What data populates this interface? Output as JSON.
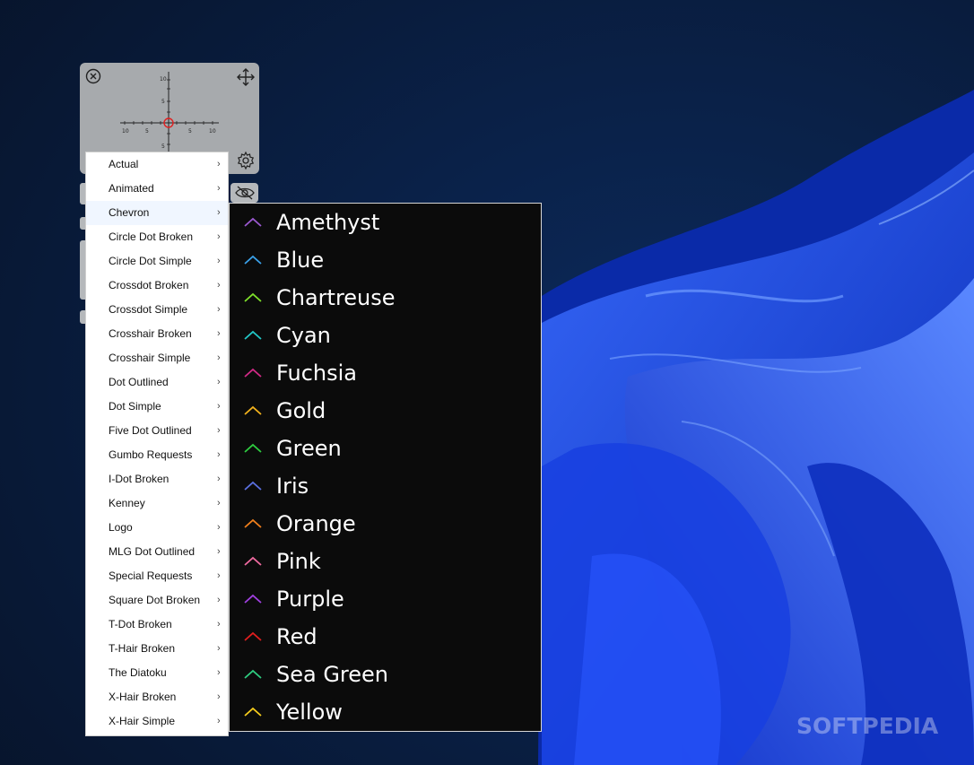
{
  "watermark": "SOFTPEDIA",
  "widget": {
    "preview_ticks": {
      "top": "10",
      "top_mid": "5",
      "bottom_mid": "5",
      "left_far": "10",
      "left_near": "5",
      "right_near": "5",
      "right_far": "10"
    }
  },
  "menu": {
    "items": [
      {
        "label": "Actual"
      },
      {
        "label": "Animated"
      },
      {
        "label": "Chevron"
      },
      {
        "label": "Circle Dot Broken"
      },
      {
        "label": "Circle Dot Simple"
      },
      {
        "label": "Crossdot Broken"
      },
      {
        "label": "Crossdot Simple"
      },
      {
        "label": "Crosshair Broken"
      },
      {
        "label": "Crosshair Simple"
      },
      {
        "label": "Dot Outlined"
      },
      {
        "label": "Dot Simple"
      },
      {
        "label": "Five Dot Outlined"
      },
      {
        "label": "Gumbo Requests"
      },
      {
        "label": "I-Dot Broken"
      },
      {
        "label": "Kenney"
      },
      {
        "label": "Logo"
      },
      {
        "label": "MLG Dot Outlined"
      },
      {
        "label": "Special Requests"
      },
      {
        "label": "Square Dot Broken"
      },
      {
        "label": "T-Dot Broken"
      },
      {
        "label": "T-Hair Broken"
      },
      {
        "label": "The Diatoku"
      },
      {
        "label": "X-Hair Broken"
      },
      {
        "label": "X-Hair Simple"
      }
    ],
    "chevron_glyph": "›",
    "highlighted_item": "Chevron"
  },
  "submenu": {
    "items": [
      {
        "label": "Amethyst",
        "color": "#9b59d0"
      },
      {
        "label": "Blue",
        "color": "#3aa0e8"
      },
      {
        "label": "Chartreuse",
        "color": "#7ee02a"
      },
      {
        "label": "Cyan",
        "color": "#22c7c7"
      },
      {
        "label": "Fuchsia",
        "color": "#d12a86"
      },
      {
        "label": "Gold",
        "color": "#f2b21c"
      },
      {
        "label": "Green",
        "color": "#2ecc40"
      },
      {
        "label": "Iris",
        "color": "#5a6fe0"
      },
      {
        "label": "Orange",
        "color": "#f07f1c"
      },
      {
        "label": "Pink",
        "color": "#f06aa0"
      },
      {
        "label": "Purple",
        "color": "#a040e0"
      },
      {
        "label": "Red",
        "color": "#e01e1e"
      },
      {
        "label": "Sea Green",
        "color": "#2ecc80"
      },
      {
        "label": "Yellow",
        "color": "#f5cc1c"
      }
    ]
  }
}
